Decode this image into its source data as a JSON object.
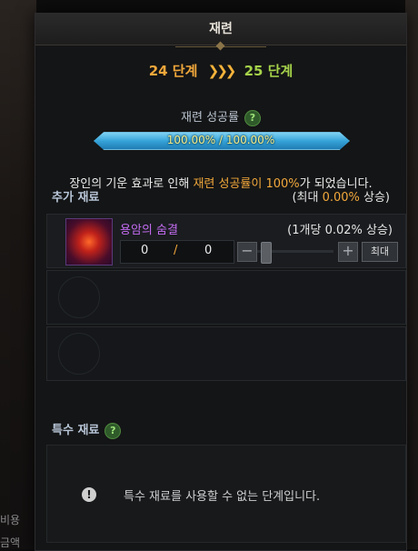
{
  "background": {
    "left_labels": [
      "비용",
      "금액"
    ]
  },
  "panel": {
    "title": "재련"
  },
  "stage": {
    "from": "24 단계",
    "arrows": "❯❯❯",
    "to": "25 단계"
  },
  "success_rate": {
    "label": "재련 성공률",
    "help": "?",
    "value_text": "100.00% / 100.00%",
    "fill_percent": 100
  },
  "message": {
    "prefix": "장인의 기운 효과로 인해 ",
    "highlight": "재련 성공률이 100%",
    "suffix": "가 되었습니다."
  },
  "extra_materials": {
    "title": "추가 재료",
    "bonus_prefix": "(최대 ",
    "bonus_value": "0.00%",
    "bonus_suffix": " 상승)",
    "items": [
      {
        "name": "용암의 숨결",
        "note": "(1개당 0.02% 상승)",
        "current": "0",
        "separator": "/",
        "max": "0",
        "minus": "−",
        "plus": "+",
        "max_label": "최대"
      }
    ]
  },
  "special_materials": {
    "title": "특수 재료",
    "help": "?",
    "warn_icon": "!",
    "message": "특수 재료를 사용할 수 없는 단계입니다."
  },
  "colors": {
    "stage_from": "#f2a83b",
    "stage_to": "#a6d34a",
    "material_name": "#c36bf0",
    "highlight": "#f2a83b"
  }
}
